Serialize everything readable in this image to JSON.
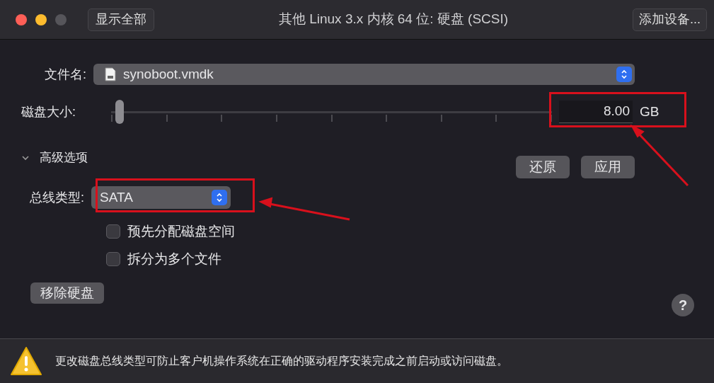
{
  "window": {
    "title": "其他 Linux 3.x 内核 64 位: 硬盘 (SCSI)",
    "controls": [
      {
        "kind": "close",
        "disabled": false
      },
      {
        "kind": "minimize",
        "disabled": false
      },
      {
        "kind": "zoom",
        "disabled": true
      }
    ]
  },
  "toolbar": {
    "show_all": "显示全部",
    "add_device": "添加设备..."
  },
  "file": {
    "label": "文件名:",
    "value": "synoboot.vmdk"
  },
  "disk_size": {
    "label": "磁盘大小:",
    "level": 0.01,
    "value": "8.00",
    "unit": "GB"
  },
  "advanced": {
    "label": "高级选项",
    "expanded": true
  },
  "actions": [
    "还原",
    "应用"
  ],
  "bus_type": {
    "label": "总线类型:",
    "value": "SATA"
  },
  "options": [
    {
      "label": "预先分配磁盘空间",
      "checked": false
    },
    {
      "label": "拆分为多个文件",
      "checked": false
    }
  ],
  "remove_button": "移除硬盘",
  "help": "?",
  "warning": "更改磁盘总线类型可防止客户机操作系统在正确的驱动程序安装完成之前启动或访问磁盘。"
}
